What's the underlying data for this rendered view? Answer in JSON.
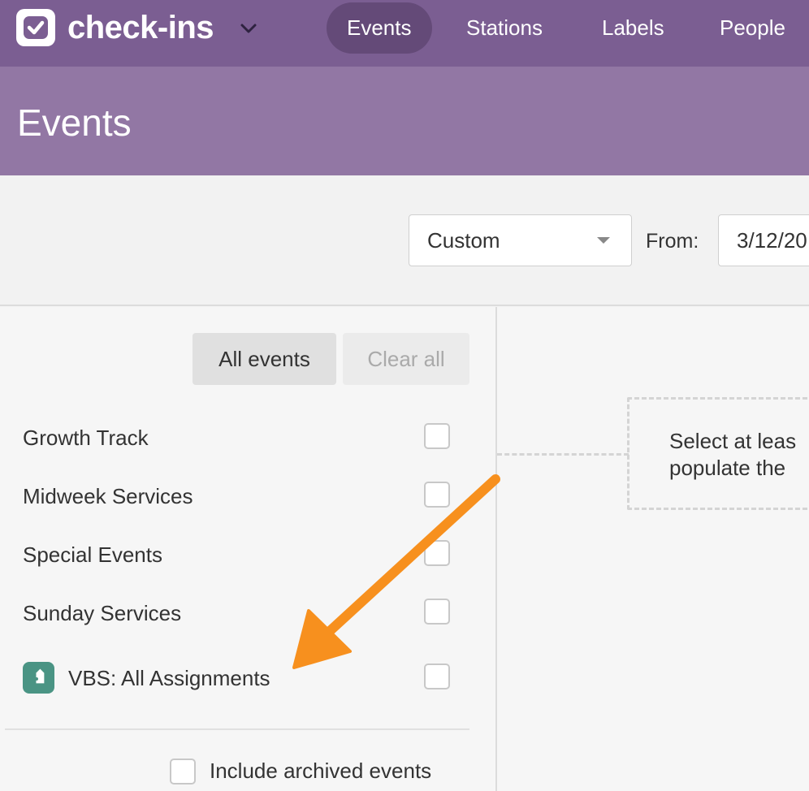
{
  "app": {
    "title": "check-ins",
    "logo_icon": "check-icon",
    "switcher_icon": "chevron-down-icon"
  },
  "nav": [
    {
      "label": "Events",
      "active": true
    },
    {
      "label": "Stations",
      "active": false
    },
    {
      "label": "Labels",
      "active": false
    },
    {
      "label": "People",
      "active": false
    }
  ],
  "page": {
    "title": "Events"
  },
  "filters": {
    "range_select": "Custom",
    "from_label": "From:",
    "from_value": "3/12/20"
  },
  "actions": {
    "all_events": "All events",
    "clear_all": "Clear all"
  },
  "events": [
    {
      "label": "Growth Track",
      "checked": false
    },
    {
      "label": "Midweek Services",
      "checked": false
    },
    {
      "label": "Special Events",
      "checked": false
    },
    {
      "label": "Sunday Services",
      "checked": false
    },
    {
      "label": "VBS: All Assignments",
      "checked": false,
      "icon": "tag-icon",
      "icon_color": "#4a9484"
    }
  ],
  "archived": {
    "label": "Include archived events",
    "checked": false
  },
  "empty_state": {
    "line1": "Select at leas",
    "line2": "populate the "
  },
  "colors": {
    "nav_bg": "#7b5e92",
    "nav_active": "#644a78",
    "header_bg": "#9277a4",
    "annotation_arrow": "#f7901e"
  }
}
